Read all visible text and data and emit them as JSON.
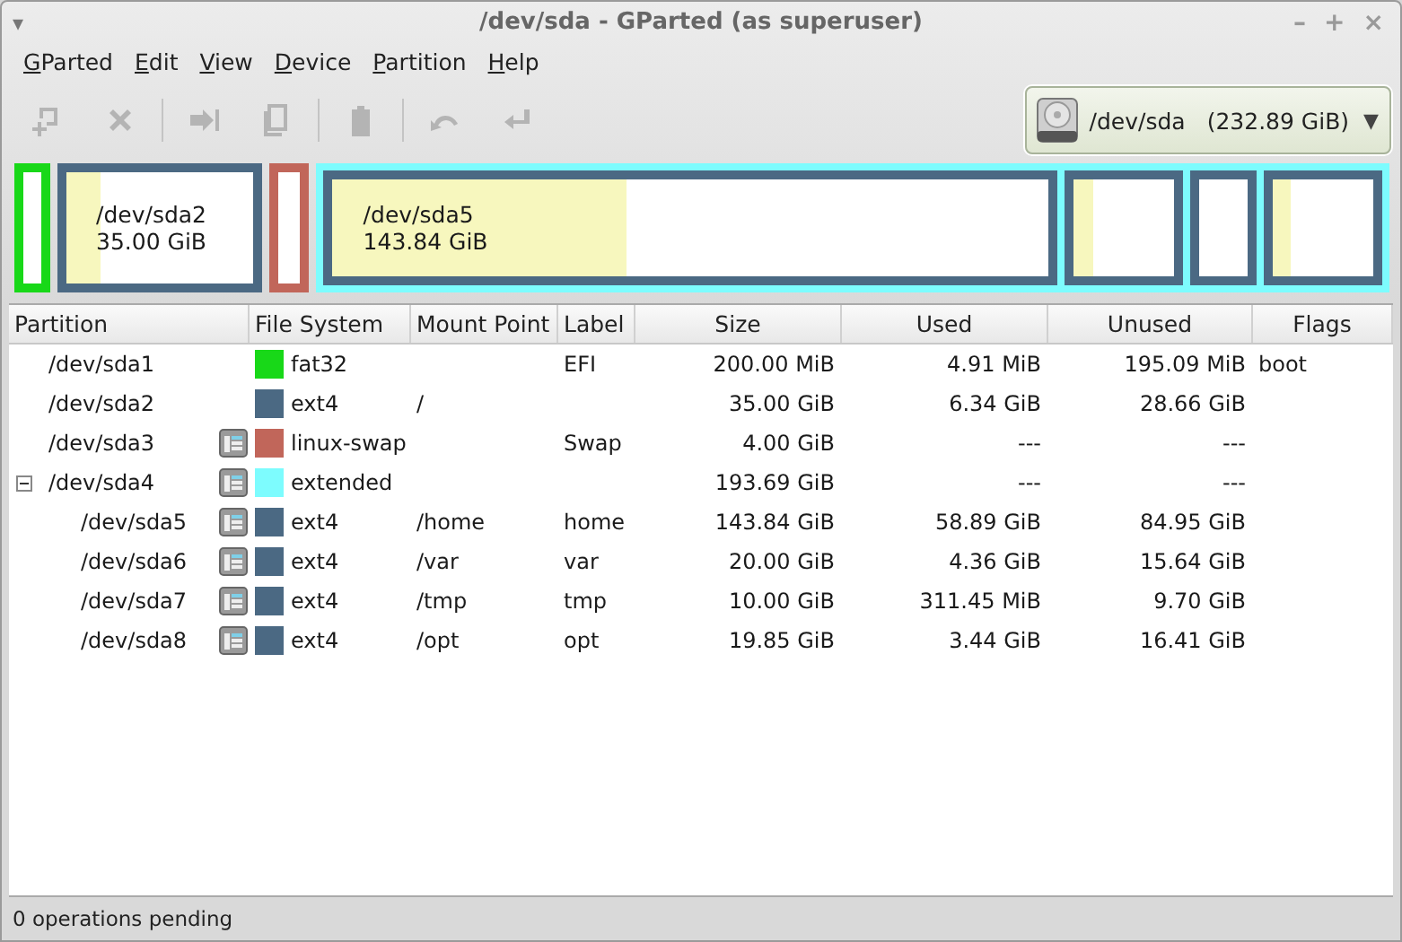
{
  "window": {
    "menu_glyph": "▾",
    "title": "/dev/sda - GParted (as superuser)",
    "controls": [
      "–",
      "+",
      "×"
    ]
  },
  "menu": [
    "GParted",
    "Edit",
    "View",
    "Device",
    "Partition",
    "Help"
  ],
  "toolbar": [
    {
      "kind": "new",
      "disabled": true
    },
    {
      "kind": "delete",
      "disabled": true
    },
    {
      "kind": "resize",
      "disabled": true
    },
    {
      "kind": "copy",
      "disabled": true
    },
    {
      "kind": "paste",
      "disabled": true
    },
    {
      "kind": "undo",
      "disabled": true
    },
    {
      "kind": "apply",
      "disabled": true
    }
  ],
  "device": {
    "name": "/dev/sda",
    "size": "(232.89 GiB)",
    "caret": "▼"
  },
  "disk_map": [
    {
      "color": "#18d818"
    },
    {
      "color": "#4b6983",
      "level": 0.19,
      "name": "/dev/sda2",
      "size": "35.00 GiB"
    },
    {
      "color": "#c1665a"
    },
    {
      "color": "#7dfcfe",
      "kind": "extended",
      "children": [
        {
          "color": "#4b6983",
          "level": 0.41,
          "name": "/dev/sda5",
          "size": "143.84 GiB"
        },
        {
          "color": "#4b6983",
          "level": 0.2
        },
        {
          "color": "#4b6983"
        },
        {
          "color": "#4b6983",
          "level": 0.17
        }
      ]
    }
  ],
  "table": {
    "columns": [
      "Partition",
      "File System",
      "Mount Point",
      "Label",
      "Size",
      "Used",
      "Unused",
      "Flags"
    ],
    "rows": [
      {
        "partition": "/dev/sda1",
        "busy": false,
        "color": "#18d818",
        "fs": "fat32",
        "label": "EFI",
        "size": "200.00 MiB",
        "used": "4.91 MiB",
        "unused": "195.09 MiB",
        "flags": "boot"
      },
      {
        "partition": "/dev/sda2",
        "busy": false,
        "color": "#4b6983",
        "fs": "ext4",
        "mount": "/",
        "size": "35.00 GiB",
        "used": "6.34 GiB",
        "unused": "28.66 GiB"
      },
      {
        "partition": "/dev/sda3",
        "busy": true,
        "color": "#c1665a",
        "fs": "linux-swap",
        "label": "Swap",
        "size": "4.00 GiB",
        "used": "---",
        "unused": "---"
      },
      {
        "partition": "/dev/sda4",
        "busy": true,
        "expanded": true,
        "color": "#7dfcfe",
        "fs": "extended",
        "size": "193.69 GiB",
        "used": "---",
        "unused": "---",
        "children": [
          {
            "partition": "/dev/sda5",
            "busy": true,
            "color": "#4b6983",
            "fs": "ext4",
            "mount": "/home",
            "label": "home",
            "size": "143.84 GiB",
            "used": "58.89 GiB",
            "unused": "84.95 GiB"
          },
          {
            "partition": "/dev/sda6",
            "busy": true,
            "color": "#4b6983",
            "fs": "ext4",
            "mount": "/var",
            "label": "var",
            "size": "20.00 GiB",
            "used": "4.36 GiB",
            "unused": "15.64 GiB"
          },
          {
            "partition": "/dev/sda7",
            "busy": true,
            "color": "#4b6983",
            "fs": "ext4",
            "mount": "/tmp",
            "label": "tmp",
            "size": "10.00 GiB",
            "used": "311.45 MiB",
            "unused": "9.70 GiB"
          },
          {
            "partition": "/dev/sda8",
            "busy": true,
            "color": "#4b6983",
            "fs": "ext4",
            "mount": "/opt",
            "label": "opt",
            "size": "19.85 GiB",
            "used": "3.44 GiB",
            "unused": "16.41 GiB"
          }
        ]
      }
    ]
  },
  "status_bar": "0 operations pending"
}
